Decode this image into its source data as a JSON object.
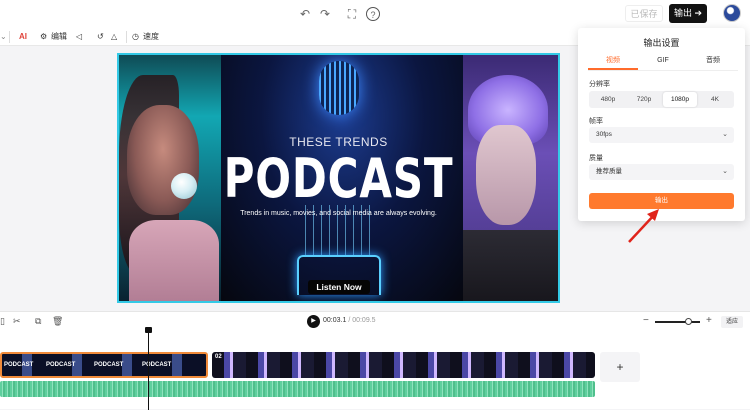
{
  "header": {
    "saved_label": "已保存",
    "export_label": "输出 ➔",
    "undo_icon": "undo-icon",
    "redo_icon": "redo-icon",
    "fit_icon": "fit-screen-icon",
    "help_icon": "help-icon"
  },
  "toolbar": {
    "ai_label": "AI",
    "edit_label": "编辑",
    "speed_label": "速度"
  },
  "video": {
    "subtitle": "THESE TRENDS",
    "title": "PODCAST",
    "description": "Trends in music, movies, and social media are always evolving.",
    "button": "Listen Now"
  },
  "export_panel": {
    "title": "输出设置",
    "tabs": [
      "视频",
      "GIF",
      "音频"
    ],
    "active_tab": "视频",
    "resolution_label": "分辨率",
    "resolutions": [
      "480p",
      "720p",
      "1080p",
      "4K"
    ],
    "selected_resolution": "1080p",
    "framerate_label": "帧率",
    "framerate_value": "30fps",
    "quality_label": "质量",
    "quality_value": "推荐质量",
    "export_button": "输出"
  },
  "timeline": {
    "current_time": "00:03.1",
    "total_time": "/ 00:09.5",
    "fit_label": "适应",
    "clip2_number": "02",
    "clip_caption": "PODCAST",
    "add_label": "+"
  },
  "colors": {
    "accent": "#ff7a2e",
    "selection": "#33c9e6",
    "audio": "#5fcf9e"
  }
}
